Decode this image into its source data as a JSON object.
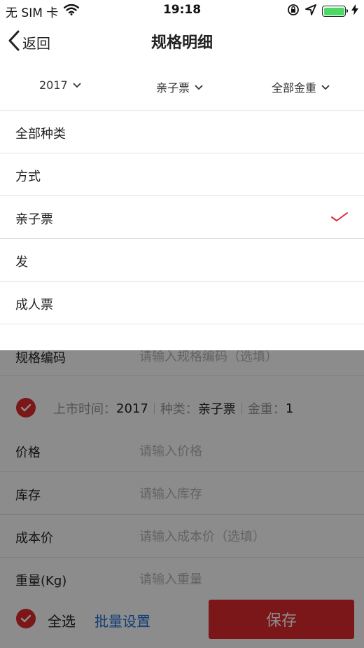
{
  "status_bar": {
    "carrier": "无 SIM 卡",
    "time": "19:18"
  },
  "nav": {
    "back_label": "返回",
    "title": "规格明细"
  },
  "filters": [
    {
      "label": "2017"
    },
    {
      "label": "亲子票"
    },
    {
      "label": "全部金重"
    }
  ],
  "dropdown": {
    "items": [
      {
        "label": "全部种类",
        "selected": false
      },
      {
        "label": "方式",
        "selected": false
      },
      {
        "label": "亲子票",
        "selected": true
      },
      {
        "label": "发",
        "selected": false
      },
      {
        "label": "成人票",
        "selected": false
      }
    ]
  },
  "form": {
    "spec_code": {
      "label": "规格编码",
      "placeholder": "请输入规格编码（选填）"
    },
    "price": {
      "label": "价格",
      "placeholder": "请输入价格"
    },
    "stock": {
      "label": "库存",
      "placeholder": "请输入库存"
    },
    "cost": {
      "label": "成本价",
      "placeholder": "请输入成本价（选填）"
    },
    "weight": {
      "label": "重量(Kg)",
      "placeholder": "请输入重量"
    }
  },
  "spec_summary": {
    "time_key": "上市时间：",
    "time_val": "2017",
    "type_key": "种类：",
    "type_val": "亲子票",
    "weight_key": "金重：",
    "weight_val": "1"
  },
  "bottom": {
    "select_all": "全选",
    "batch_settings": "批量设置",
    "save": "保存"
  },
  "colors": {
    "accent_red": "#e0282e",
    "link_blue": "#1e6fd9",
    "battery_green": "#4cd964"
  }
}
